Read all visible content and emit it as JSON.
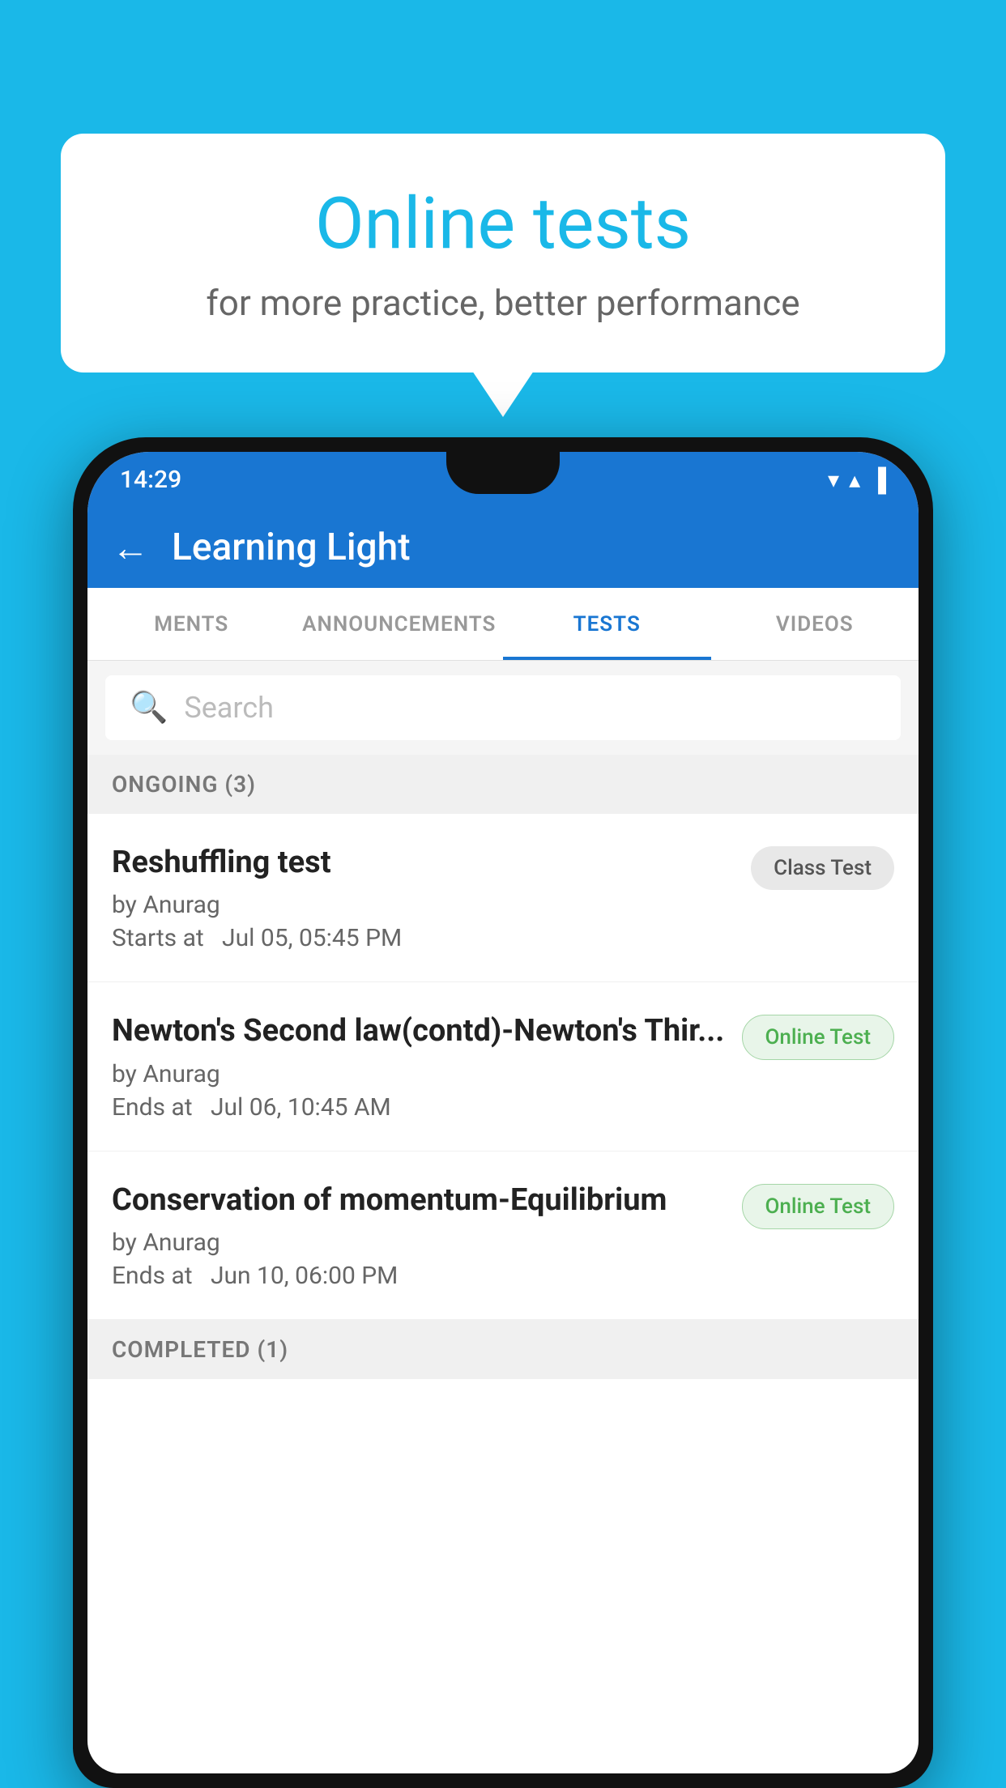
{
  "background": {
    "color": "#1ab8e8"
  },
  "speech_bubble": {
    "title": "Online tests",
    "subtitle": "for more practice, better performance"
  },
  "phone": {
    "status_bar": {
      "time": "14:29",
      "wifi": "▼",
      "signal": "▲",
      "battery": "▐"
    },
    "app_bar": {
      "back_label": "←",
      "title": "Learning Light"
    },
    "tabs": [
      {
        "label": "MENTS",
        "active": false
      },
      {
        "label": "ANNOUNCEMENTS",
        "active": false
      },
      {
        "label": "TESTS",
        "active": true
      },
      {
        "label": "VIDEOS",
        "active": false
      }
    ],
    "search": {
      "placeholder": "Search"
    },
    "ongoing_section": {
      "label": "ONGOING (3)",
      "tests": [
        {
          "name": "Reshuffling test",
          "author": "by Anurag",
          "time_label": "Starts at",
          "time_value": "Jul 05, 05:45 PM",
          "badge": "Class Test",
          "badge_type": "class"
        },
        {
          "name": "Newton's Second law(contd)-Newton's Thir...",
          "author": "by Anurag",
          "time_label": "Ends at",
          "time_value": "Jul 06, 10:45 AM",
          "badge": "Online Test",
          "badge_type": "online"
        },
        {
          "name": "Conservation of momentum-Equilibrium",
          "author": "by Anurag",
          "time_label": "Ends at",
          "time_value": "Jun 10, 06:00 PM",
          "badge": "Online Test",
          "badge_type": "online"
        }
      ]
    },
    "completed_section": {
      "label": "COMPLETED (1)"
    }
  }
}
